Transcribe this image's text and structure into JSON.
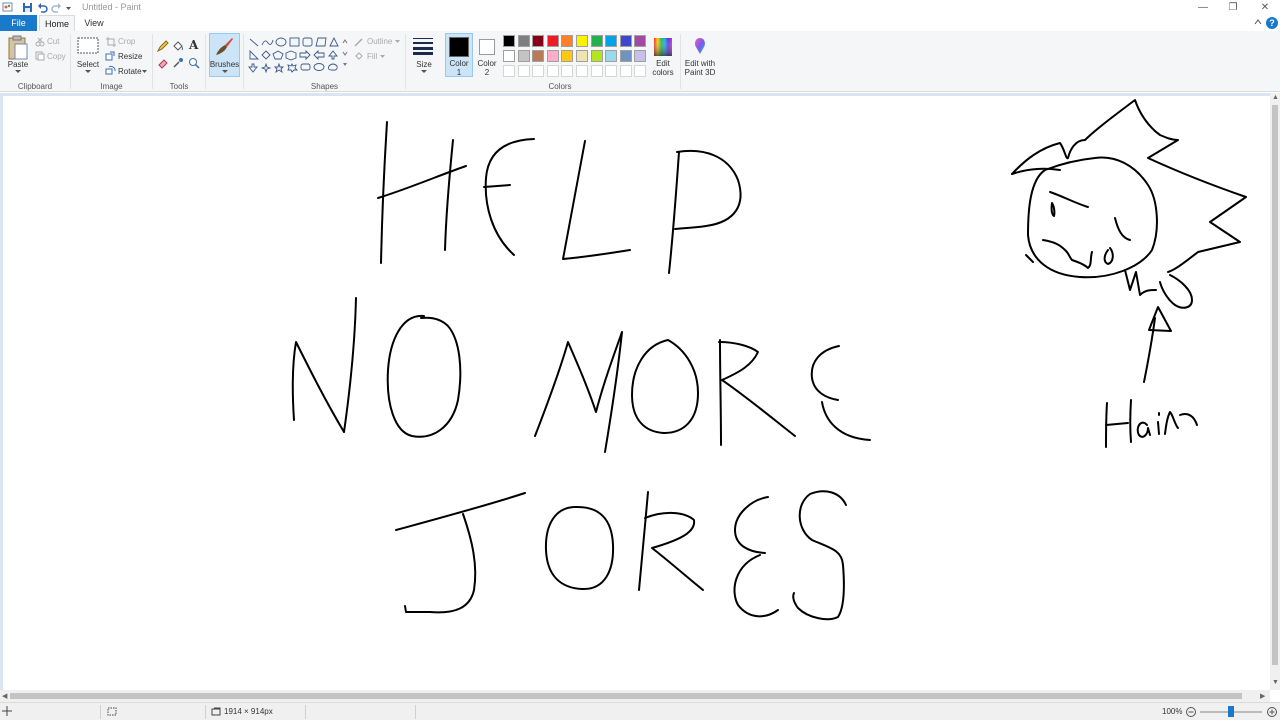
{
  "window": {
    "title": "Untitled - Paint",
    "minimize": "—",
    "restore": "❐",
    "close": "✕"
  },
  "tabs": {
    "file": "File",
    "home": "Home",
    "view": "View",
    "help": "?"
  },
  "ribbon": {
    "clipboard": {
      "label": "Clipboard",
      "paste": "Paste",
      "cut": "Cut",
      "copy": "Copy"
    },
    "image": {
      "label": "Image",
      "select": "Select",
      "crop": "Crop",
      "resize": "Resize",
      "rotate": "Rotate"
    },
    "tools": {
      "label": "Tools",
      "text_glyph": "A"
    },
    "brushes": {
      "label": "Brushes"
    },
    "shapes": {
      "label": "Shapes",
      "outline": "Outline",
      "fill": "Fill"
    },
    "size": {
      "label": "Size"
    },
    "color1": {
      "label_line1": "Color",
      "label_line2": "1",
      "value": "#000000"
    },
    "color2": {
      "label_line1": "Color",
      "label_line2": "2",
      "value": "#ffffff"
    },
    "colors": {
      "label": "Colors",
      "row1": [
        "#000000",
        "#7f7f7f",
        "#880015",
        "#ed1c24",
        "#ff7f27",
        "#fff200",
        "#22b14c",
        "#00a2e8",
        "#3f48cc",
        "#a349a4"
      ],
      "row2": [
        "#ffffff",
        "#c3c3c3",
        "#b97a57",
        "#ffaec9",
        "#ffc90e",
        "#efe4b0",
        "#b5e61d",
        "#99d9ea",
        "#7092be",
        "#c8bfe7"
      ]
    },
    "edit_colors": {
      "line1": "Edit",
      "line2": "colors"
    },
    "paint3d": {
      "line1": "Edit with",
      "line2": "Paint 3D"
    }
  },
  "canvas": {
    "strokes_color": "#000000"
  },
  "statusbar": {
    "dimensions": "1914 × 914px",
    "zoom": "100%"
  }
}
